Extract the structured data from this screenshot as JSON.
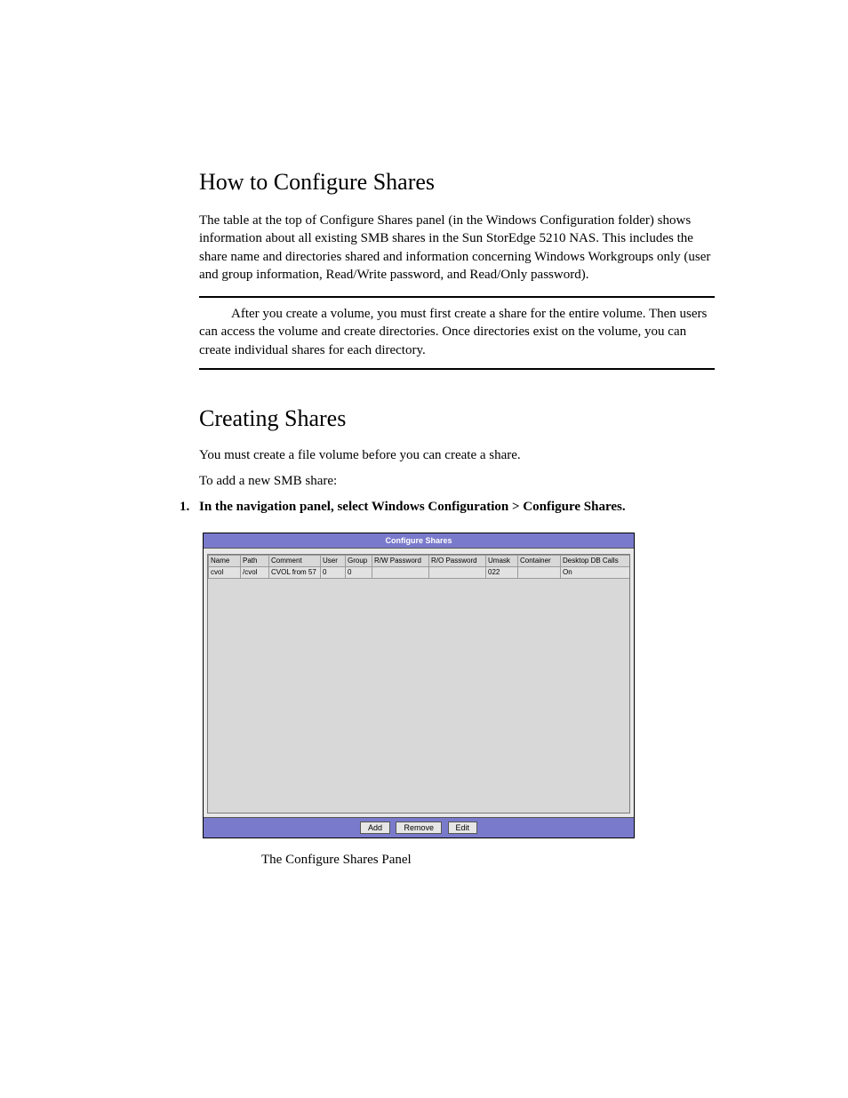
{
  "section1": {
    "heading": "How to Configure Shares",
    "para": "The table at the top of Configure Shares panel (in the Windows Configuration folder) shows information about all existing SMB shares in the Sun StorEdge 5210 NAS. This includes the share name and directories shared and information concerning Windows Workgroups only (user and group information, Read/Write password, and Read/Only password).",
    "note": "After you create a volume, you must first create a share for the entire volume. Then users can access the volume and create directories. Once directories exist on the volume, you can create individual shares for each directory."
  },
  "section2": {
    "heading": "Creating Shares",
    "intro1": "You must create a file volume before you can create a share.",
    "intro2": "To add a new SMB share:",
    "step1_num": "1.",
    "step1_text": "In the navigation panel, select Windows Configuration > Configure Shares."
  },
  "panel": {
    "title": "Configure Shares",
    "columns": [
      "Name",
      "Path",
      "Comment",
      "User",
      "Group",
      "R/W Password",
      "R/O Password",
      "Umask",
      "Container",
      "Desktop DB Calls"
    ],
    "row": {
      "name": "cvol",
      "path": "/cvol",
      "comment": "CVOL from 57",
      "user": "0",
      "group": "0",
      "rw": "",
      "ro": "",
      "umask": "022",
      "container": "",
      "desktop": "On"
    },
    "buttons": {
      "add": "Add",
      "remove": "Remove",
      "edit": "Edit"
    }
  },
  "caption": "The Configure Shares Panel"
}
